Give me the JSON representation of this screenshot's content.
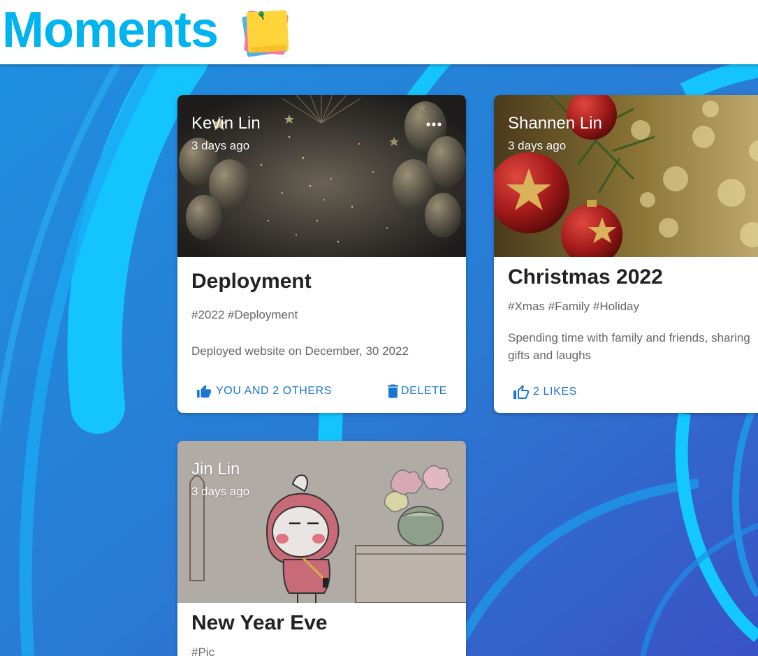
{
  "app": {
    "title": "Moments",
    "logo_icon": "sticky-notes-icon"
  },
  "colors": {
    "title": "#00b4f0",
    "background": "#2a7fd4",
    "accent": "#1976d2",
    "muted_text": "#666666"
  },
  "posts": [
    {
      "author": "Kevin Lin",
      "time": "3 days ago",
      "title": "Deployment",
      "tags": "#2022 #Deployment",
      "message": "Deployed website on December, 30 2022",
      "like_label": "YOU AND 2 OTHERS",
      "like_icon": "thumb-up-filled-icon",
      "delete_label": "DELETE",
      "delete_icon": "trash-icon",
      "more_icon": "more-horizontal-icon",
      "image": "gold-balloons-celebration-image"
    },
    {
      "author": "Shannen Lin",
      "time": "3 days ago",
      "title": "Christmas 2022",
      "tags": "#Xmas #Family #Holiday",
      "message_line1": "Spending time with family and friends, sharing",
      "message_line2": "gifts and laughs",
      "like_label": "2 LIKES",
      "like_icon": "thumb-up-outline-icon",
      "image": "christmas-ornaments-image"
    },
    {
      "author": "Jin Lin",
      "time": "3 days ago",
      "title": "New Year Eve",
      "tags": "#Pic",
      "image": "cartoon-character-image"
    }
  ]
}
